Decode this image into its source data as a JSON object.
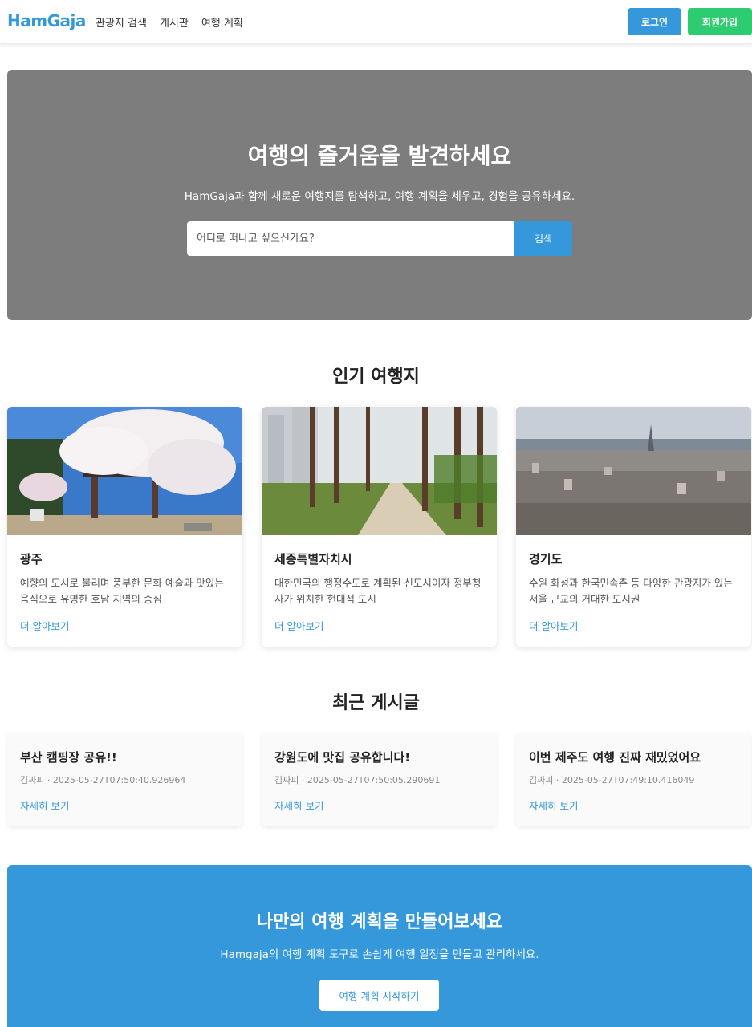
{
  "header": {
    "logo": "HamGaja",
    "nav": [
      "관광지 검색",
      "게시판",
      "여행 계획"
    ],
    "login_label": "로그인",
    "signup_label": "회원가입"
  },
  "hero": {
    "title": "여행의 즐거움을 발견하세요",
    "subtitle": "HamGaja과 함께 새로운 여행지를 탐색하고, 여행 계획을 세우고, 경험을 공유하세요.",
    "search_placeholder": "어디로 떠나고 싶으신가요?",
    "search_label": "검색"
  },
  "popular": {
    "title": "인기 여행지",
    "cards": [
      {
        "name": "광주",
        "desc": "예향의 도시로 불리며 풍부한 문화 예술과 맛있는 음식으로 유명한 호남 지역의 중심",
        "link": "더 알아보기"
      },
      {
        "name": "세종특별자치시",
        "desc": "대한민국의 행정수도로 계획된 신도시이자 정부청사가 위치한 현대적 도시",
        "link": "더 알아보기"
      },
      {
        "name": "경기도",
        "desc": "수원 화성과 한국민속촌 등 다양한 관광지가 있는 서울 근교의 거대한 도시권",
        "link": "더 알아보기"
      }
    ]
  },
  "recent": {
    "title": "최근 게시글",
    "posts": [
      {
        "title": "부산 캠핑장 공유!!",
        "meta": "김싸피 · 2025-05-27T07:50:40.926964",
        "link": "자세히 보기"
      },
      {
        "title": "강원도에 맛집 공유합니다!",
        "meta": "김싸피 · 2025-05-27T07:50:05.290691",
        "link": "자세히 보기"
      },
      {
        "title": "이번 제주도 여행 진짜 재밌었어요",
        "meta": "김싸피 · 2025-05-27T07:49:10.416049",
        "link": "자세히 보기"
      }
    ]
  },
  "cta": {
    "title": "나만의 여행 계획을 만들어보세요",
    "subtitle": "Hamgaja의 여행 계획 도구로 손쉽게 여행 일정을 만들고 관리하세요.",
    "button": "여행 계획 시작하기"
  },
  "colors": {
    "accent": "#3498db",
    "signup": "#2ecc71",
    "hero_bg": "#7d7d7d"
  }
}
